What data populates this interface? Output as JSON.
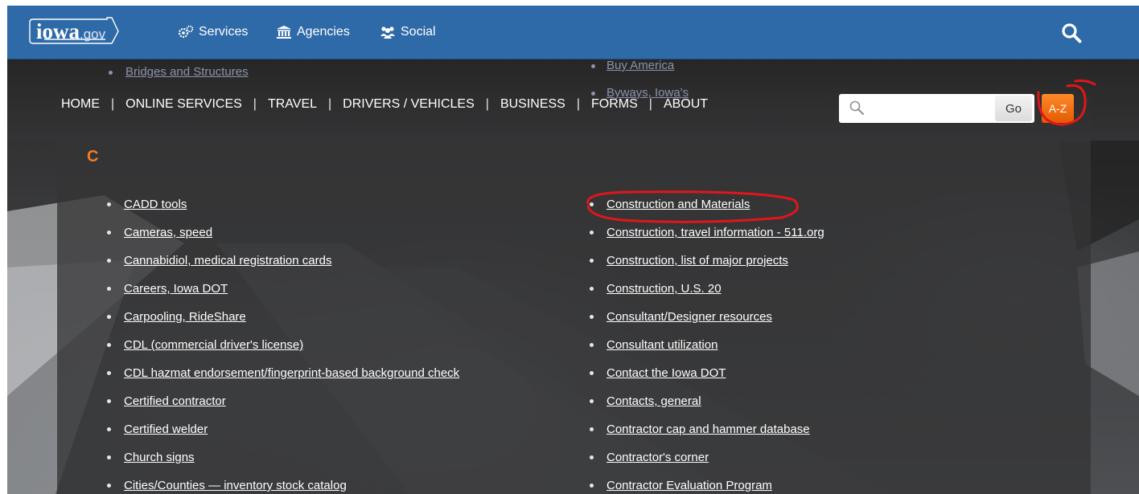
{
  "topbar": {
    "logo_main": "iowa",
    "logo_suffix": ".gov",
    "services_label": "Services",
    "agencies_label": "Agencies",
    "social_label": "Social",
    "search_icon": "search-icon"
  },
  "peek_links": {
    "left": "Bridges and Structures",
    "right_top": "Buy America",
    "right_bottom": "Byways, Iowa's"
  },
  "mainnav": {
    "items": [
      "HOME",
      "ONLINE SERVICES",
      "TRAVEL",
      "DRIVERS / VEHICLES",
      "BUSINESS",
      "FORMS",
      "ABOUT"
    ],
    "separator": "|"
  },
  "search": {
    "placeholder": "",
    "go_label": "Go",
    "az_label": "A-Z"
  },
  "section_letter": "C",
  "left_links": [
    "CADD tools",
    "Cameras, speed",
    "Cannabidiol, medical registration cards",
    "Careers, Iowa DOT",
    "Carpooling, RideShare",
    "CDL (commercial driver's license)",
    "CDL hazmat endorsement/fingerprint-based background check",
    "Certified contractor",
    "Certified welder",
    "Church signs",
    "Cities/Counties — inventory stock catalog"
  ],
  "right_links": [
    "Construction and Materials",
    "Construction, travel information - 511.org",
    "Construction, list of major projects",
    "Construction, U.S. 20",
    "Consultant/Designer resources",
    "Consultant utilization",
    "Contact the Iowa DOT",
    "Contacts, general",
    "Contractor cap and hammer database",
    "Contractor's corner",
    "Contractor Evaluation Program"
  ],
  "colors": {
    "topbar": "#2f6aa8",
    "accent_orange": "#f07e26",
    "annotation_red": "#e0161b"
  }
}
